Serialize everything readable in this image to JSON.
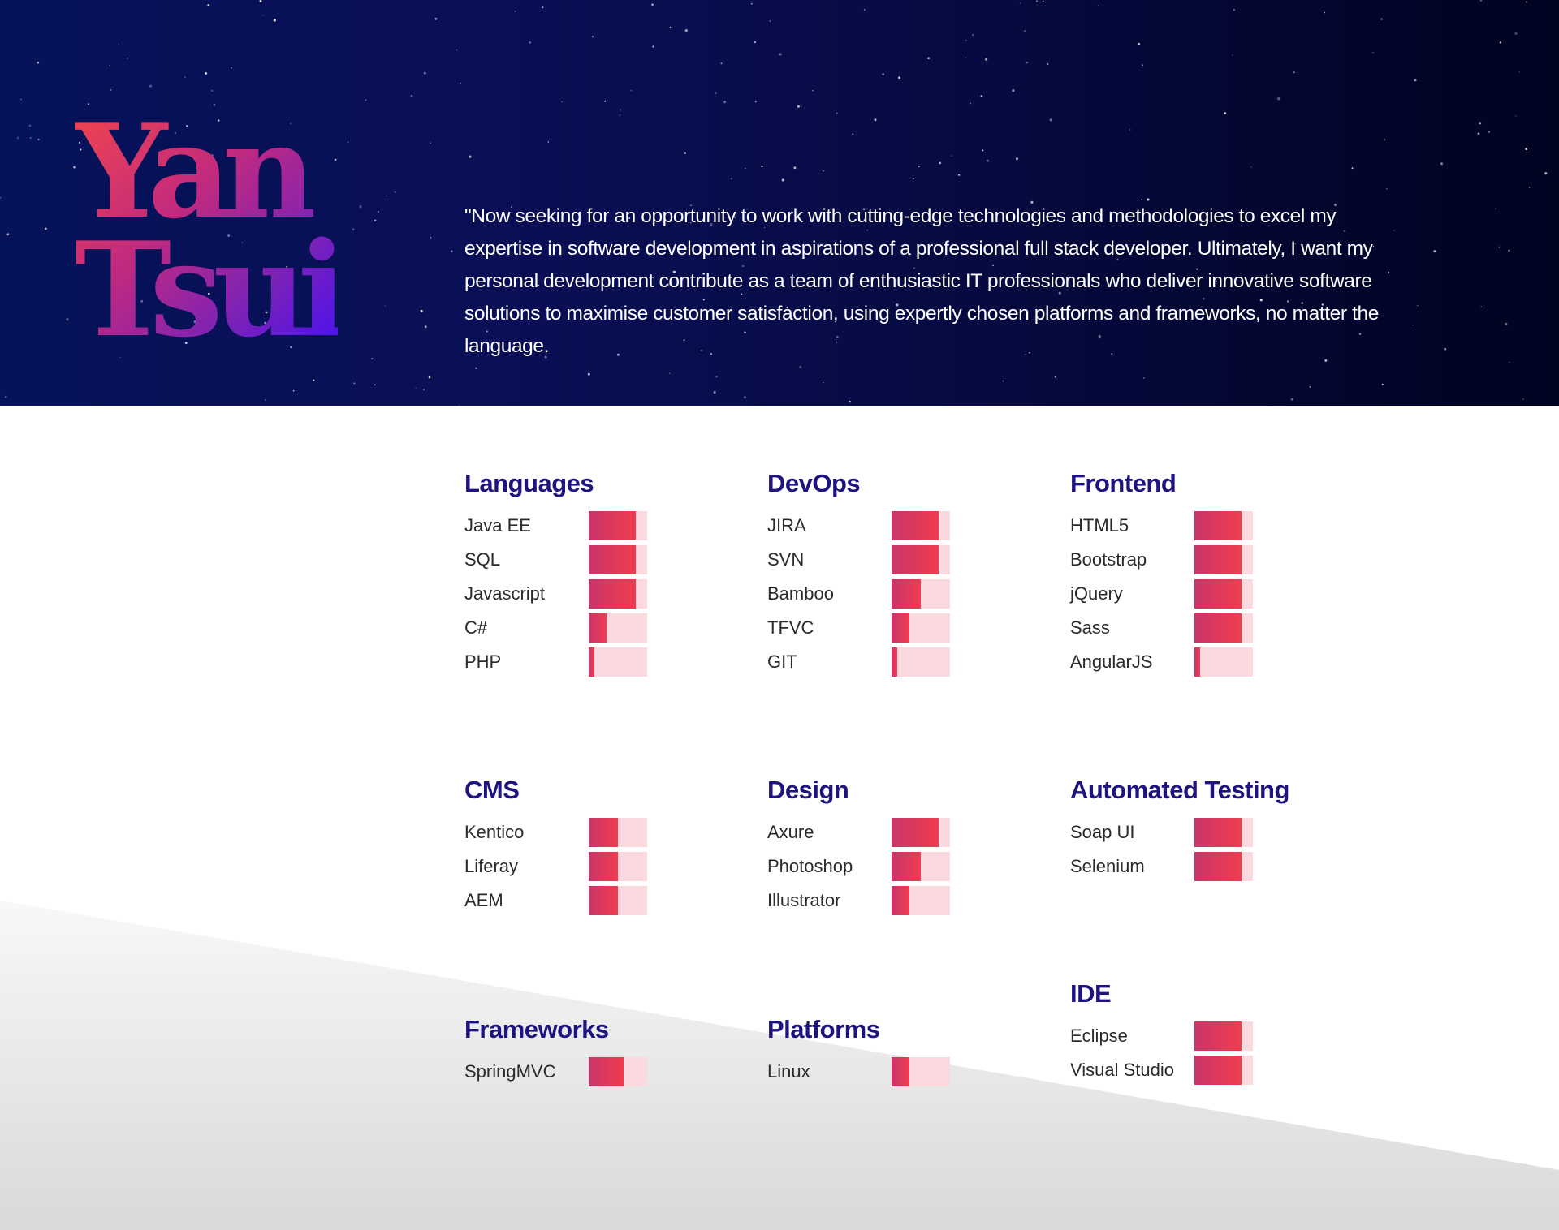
{
  "hero": {
    "name_line1": "Yan",
    "name_line2": "Tsui",
    "quote": "\"Now seeking for an opportunity to work with cutting-edge technologies and methodologies to excel my expertise in software development in aspirations of a professional full stack developer. Ultimately, I want my personal development contribute as a team of enthusiastic IT professionals who deliver innovative software solutions to maximise customer satisfaction, using expertly chosen platforms and frameworks, no matter the language."
  },
  "colors": {
    "heading": "#1e1480",
    "bar_fill_start": "#c9356a",
    "bar_fill_end": "#f03c50",
    "bar_track": "#fcd9df",
    "hero_background": "#06125a"
  },
  "skill_groups": [
    {
      "title": "Languages",
      "skills": [
        {
          "name": "Java EE",
          "level": 0.8
        },
        {
          "name": "SQL",
          "level": 0.8
        },
        {
          "name": "Javascript",
          "level": 0.8
        },
        {
          "name": "C#",
          "level": 0.3
        },
        {
          "name": "PHP",
          "level": 0.1
        }
      ]
    },
    {
      "title": "DevOps",
      "skills": [
        {
          "name": "JIRA",
          "level": 0.8
        },
        {
          "name": "SVN",
          "level": 0.8
        },
        {
          "name": "Bamboo",
          "level": 0.5
        },
        {
          "name": "TFVC",
          "level": 0.3
        },
        {
          "name": "GIT",
          "level": 0.1
        }
      ]
    },
    {
      "title": "Frontend",
      "skills": [
        {
          "name": "HTML5",
          "level": 0.8
        },
        {
          "name": "Bootstrap",
          "level": 0.8
        },
        {
          "name": "jQuery",
          "level": 0.8
        },
        {
          "name": "Sass",
          "level": 0.8
        },
        {
          "name": "AngularJS",
          "level": 0.1
        }
      ]
    },
    {
      "title": "CMS",
      "skills": [
        {
          "name": "Kentico",
          "level": 0.5
        },
        {
          "name": "Liferay",
          "level": 0.5
        },
        {
          "name": "AEM",
          "level": 0.5
        }
      ]
    },
    {
      "title": "Design",
      "skills": [
        {
          "name": "Axure",
          "level": 0.8
        },
        {
          "name": "Photoshop",
          "level": 0.5
        },
        {
          "name": "Illustrator",
          "level": 0.3
        }
      ]
    },
    {
      "title": "Automated Testing",
      "skills": [
        {
          "name": "Soap UI",
          "level": 0.8
        },
        {
          "name": "Selenium",
          "level": 0.8
        }
      ]
    },
    {
      "title": "Frameworks",
      "skills": [
        {
          "name": "SpringMVC",
          "level": 0.6
        }
      ]
    },
    {
      "title": "Platforms",
      "skills": [
        {
          "name": "Linux",
          "level": 0.3
        }
      ]
    },
    {
      "title": "IDE",
      "skills": [
        {
          "name": "Eclipse",
          "level": 0.8
        },
        {
          "name": "Visual Studio",
          "level": 0.8
        }
      ]
    }
  ]
}
